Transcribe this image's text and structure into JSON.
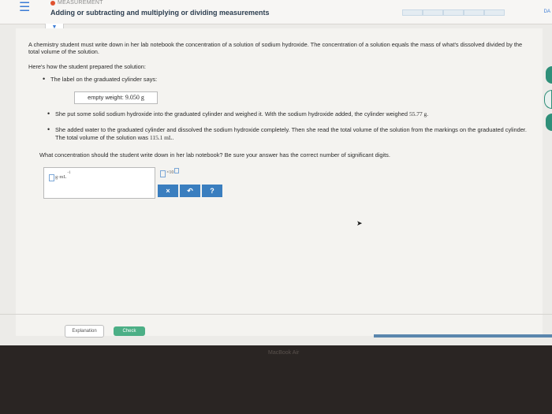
{
  "header": {
    "topic": "MEASUREMENT",
    "title": "Adding or subtracting and multiplying or dividing measurements",
    "progress_segments": 5,
    "progress_filled": 0,
    "corner": "DA"
  },
  "problem": {
    "intro": "A chemistry student must write down in her lab notebook the concentration of a solution of sodium hydroxide. The concentration of a solution equals the mass of what's dissolved divided by the total volume of the solution.",
    "prep_heading": "Here's how the student prepared the solution:",
    "bullet1": "The label on the graduated cylinder says:",
    "label_prefix": "empty weight:",
    "label_value": "9.050 g",
    "bullet2_text": "She put some solid sodium hydroxide into the graduated cylinder and weighed it. With the sodium hydroxide added, the cylinder weighed",
    "bullet2_value": "55.77 g.",
    "bullet3_text": "She added water to the graduated cylinder and dissolved the sodium hydroxide completely. Then she read the total volume of the solution from the markings on the graduated cylinder. The total volume of the solution was",
    "bullet3_value": "115.1 mL.",
    "question": "What concentration should the student write down in her lab notebook? Be sure your answer has the correct number of significant digits."
  },
  "answer": {
    "unit": "g·mL",
    "unit_exp": "-1",
    "sci_times": "×10",
    "tools": [
      "×",
      "↶",
      "?"
    ]
  },
  "footer": {
    "explanation_label": "Explanation",
    "check_label": "Check"
  },
  "device": {
    "brand": "MacBook Air"
  },
  "colors": {
    "accent": "#3a7ebf",
    "check": "#4caf86",
    "topic_dot": "#e0522f"
  }
}
